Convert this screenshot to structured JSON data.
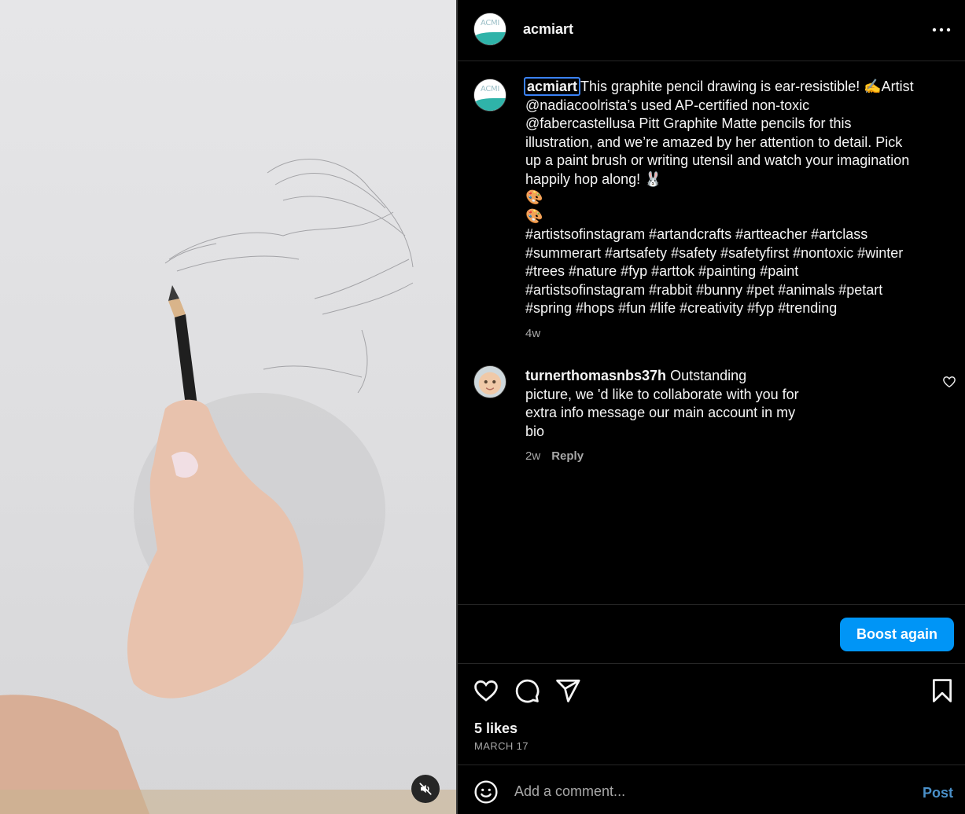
{
  "post": {
    "username": "acmiart",
    "avatar_text": "ACMI",
    "caption_username": "acmiart",
    "caption_lines": [
      "This graphite pencil drawing is ear-resistible! ✍️Artist",
      "@nadiacoolrista’s used AP-certified non-toxic",
      "@fabercastellusa Pitt Graphite Matte pencils for this",
      "illustration, and we’re amazed by her attention to detail. Pick",
      "up a paint brush or writing utensil and watch your imagination",
      "happily hop along! 🐰",
      "🎨",
      "🎨"
    ],
    "hashtag_lines": [
      "#artistsofinstagram #artandcrafts #artteacher #artclass",
      "#summerart #artsafety #safety #safetyfirst #nontoxic #winter",
      "#trees #nature #fyp #arttok #painting #paint",
      "#artistsofinstagram #rabbit #bunny #pet #animals #petart",
      "#spring #hops #fun #life #creativity #fyp #trending"
    ],
    "caption_time": "4w"
  },
  "comment": {
    "username": "turnerthomasnbs37h",
    "first_line": "Outstanding",
    "lines": [
      "picture, we 'd like to collaborate with you for",
      "extra info message our main account in my",
      "bio"
    ],
    "time": "2w",
    "reply_label": "Reply"
  },
  "boost": {
    "label": "Boost again"
  },
  "stats": {
    "likes": "5 likes",
    "date": "MARCH 17"
  },
  "comment_box": {
    "placeholder": "Add a comment...",
    "post_label": "Post"
  },
  "icons": {
    "more": "more-options-icon",
    "like": "heart-icon",
    "comment": "comment-icon",
    "share": "share-icon",
    "save": "bookmark-icon",
    "emoji": "emoji-icon",
    "mute": "muted-speaker-icon"
  },
  "colors": {
    "accent": "#0095f6",
    "background": "#000000",
    "muted_text": "#a8a8a8",
    "post_button": "#4a90c9"
  }
}
